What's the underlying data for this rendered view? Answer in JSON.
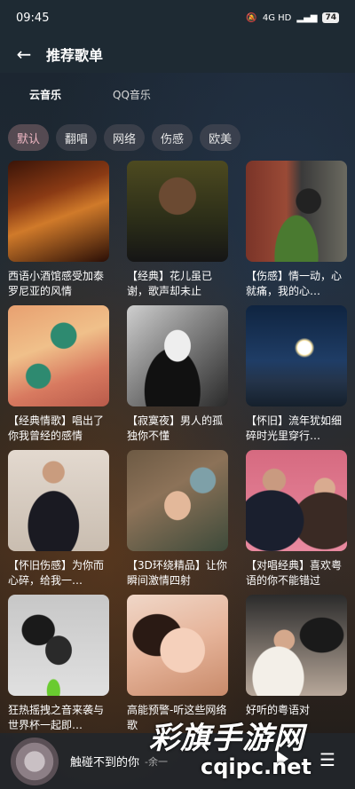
{
  "status_bar": {
    "time": "09:45",
    "network": "4G HD",
    "battery": "74"
  },
  "header": {
    "title": "推荐歌单"
  },
  "source_tabs": [
    {
      "label": "云音乐",
      "active": true
    },
    {
      "label": "QQ音乐",
      "active": false
    }
  ],
  "tags": [
    {
      "label": "默认",
      "active": true
    },
    {
      "label": "翻唱",
      "active": false
    },
    {
      "label": "网络",
      "active": false
    },
    {
      "label": "伤感",
      "active": false
    },
    {
      "label": "欧美",
      "active": false
    }
  ],
  "playlists": [
    {
      "title": "西语小酒馆感受加泰罗尼亚的风情"
    },
    {
      "title": "【经典】花儿虽已谢，歌声却未止"
    },
    {
      "title": "【伤感】情一动，心就痛，我的心…"
    },
    {
      "title": "【经典情歌】唱出了你我曾经的感情"
    },
    {
      "title": "【寂寞夜】男人的孤独你不懂"
    },
    {
      "title": "【怀旧】流年犹如细碎时光里穿行…"
    },
    {
      "title": "【怀旧伤感】为你而心碎，给我一…"
    },
    {
      "title": "【3D环绕精品】让你瞬间激情四射"
    },
    {
      "title": "【对唱经典】喜欢粤语的你不能错过"
    },
    {
      "title": "狂热摇拽之音来袭与世界杯一起即…"
    },
    {
      "title": "高能预警-听这些网络歌"
    },
    {
      "title": "好听的粤语对"
    }
  ],
  "now_playing": {
    "title": "触碰不到的你",
    "artist": "-余一"
  },
  "watermark": {
    "line1": "彩旗手游网",
    "line2": "cqipc.net"
  }
}
